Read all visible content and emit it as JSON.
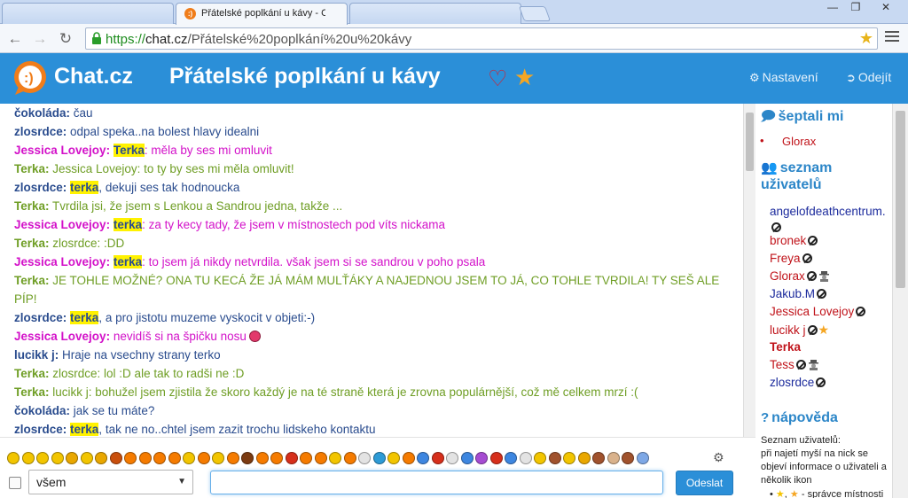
{
  "browser": {
    "tabs": [
      {
        "title": ""
      },
      {
        "title": "Přátelské poplkání u kávy - Chat.cz"
      },
      {
        "title": ""
      }
    ],
    "url_scheme": "https://",
    "url_host": "chat.cz",
    "url_path": "/Přátelské%20poplkání%20u%20kávy"
  },
  "header": {
    "logo_text": "Chat.cz",
    "room_title": "Přátelské poplkání u kávy",
    "settings_label": "Nastavení",
    "logout_label": "Odejít"
  },
  "colors": {
    "accent": "#2b8fd8",
    "nick_dark": "#2a4c8e",
    "nick_green": "#6f9e25",
    "nick_magenta": "#d312c9",
    "nick_red": "#c0131a",
    "highlight": "#fff200"
  },
  "messages": [
    {
      "nick": "čokoláda:",
      "highlight": "",
      "text": " čau",
      "color": "#2a4c8e"
    },
    {
      "nick": "zlosrdce:",
      "highlight": "",
      "text": " odpal speka..na bolest hlavy idealni",
      "color": "#2a4c8e"
    },
    {
      "nick": "Jessica Lovejoy:",
      "highlight": "Terka",
      "text": ": měla by ses mi omluvit",
      "color": "#d312c9"
    },
    {
      "nick": "Terka:",
      "highlight": "",
      "text": " Jessica Lovejoy: to ty by ses mi měla omluvit!",
      "color": "#6f9e25"
    },
    {
      "nick": "zlosrdce:",
      "highlight": "terka",
      "text": ", dekuji ses tak hodnoucka",
      "color": "#2a4c8e"
    },
    {
      "nick": "Terka:",
      "highlight": "",
      "text": " Tvrdila jsi, že jsem s Lenkou a Sandrou jedna, takže ...",
      "color": "#6f9e25"
    },
    {
      "nick": "Jessica Lovejoy:",
      "highlight": "terka",
      "text": ": za ty kecy tady, že jsem v místnostech pod víts nickama",
      "color": "#d312c9"
    },
    {
      "nick": "Terka:",
      "highlight": "",
      "text": " zlosrdce: :DD",
      "color": "#6f9e25"
    },
    {
      "nick": "Jessica Lovejoy:",
      "highlight": "terka",
      "text": ": to jsem já nikdy netvrdila. však jsem si se sandrou v poho psala",
      "color": "#d312c9"
    },
    {
      "nick": "Terka:",
      "highlight": "",
      "text": " JE TOHLE MOŽNÉ? ONA TU KECÁ ŽE JÁ MÁM MULŤÁKY A NAJEDNOU JSEM TO JÁ, CO TOHLE TVRDILA! TY SEŠ ALE PÍP!",
      "color": "#6f9e25"
    },
    {
      "nick": "zlosrdce:",
      "highlight": "terka",
      "text": ", a pro jistotu muzeme vyskocit v objeti:-)",
      "color": "#2a4c8e"
    },
    {
      "nick": "Jessica Lovejoy:",
      "highlight": "",
      "text": " nevidíš si na špičku nosu",
      "color": "#d312c9",
      "smiley": true
    },
    {
      "nick": "lucikk j:",
      "highlight": "",
      "text": " Hraje na vsechny strany terko",
      "color": "#2a4c8e"
    },
    {
      "nick": "Terka:",
      "highlight": "",
      "text": " zlosrdce: lol :D ale tak to radši ne :D",
      "color": "#6f9e25"
    },
    {
      "nick": "Terka:",
      "highlight": "",
      "text": " lucikk j: bohužel jsem zjistila že skoro každý je na té straně která je zrovna populárnější, což mě celkem mrzí :(",
      "color": "#6f9e25"
    },
    {
      "nick": "čokoláda:",
      "highlight": "",
      "text": " jak se tu máte?",
      "color": "#2a4c8e"
    },
    {
      "nick": "zlosrdce:",
      "highlight": "terka",
      "text": ", tak ne no..chtel jsem zazit trochu lidskeho kontaktu",
      "color": "#2a4c8e"
    }
  ],
  "sidebar": {
    "whisper_heading": "šeptali mi",
    "whispers": [
      "Glorax"
    ],
    "users_heading": "seznam uživatelů",
    "users": [
      {
        "name": "angelofdeathcentrum.",
        "color": "#1b2a9c",
        "ban": true,
        "spy": false,
        "star": false,
        "bold": false
      },
      {
        "name": "bronek",
        "color": "#c0131a",
        "ban": true,
        "spy": false,
        "star": false,
        "bold": false
      },
      {
        "name": "Freya",
        "color": "#c0131a",
        "ban": true,
        "spy": false,
        "star": false,
        "bold": false
      },
      {
        "name": "Glorax",
        "color": "#c0131a",
        "ban": true,
        "spy": true,
        "star": false,
        "bold": false
      },
      {
        "name": "Jakub.M",
        "color": "#1b2a9c",
        "ban": true,
        "spy": false,
        "star": false,
        "bold": false
      },
      {
        "name": "Jessica Lovejoy",
        "color": "#c0131a",
        "ban": true,
        "spy": false,
        "star": false,
        "bold": false
      },
      {
        "name": "lucikk j",
        "color": "#c0131a",
        "ban": true,
        "spy": false,
        "star": true,
        "bold": false
      },
      {
        "name": "Terka",
        "color": "#c0131a",
        "ban": false,
        "spy": false,
        "star": false,
        "bold": true
      },
      {
        "name": "Tess",
        "color": "#c0131a",
        "ban": true,
        "spy": true,
        "star": false,
        "bold": false
      },
      {
        "name": "zlosrdce",
        "color": "#1b2a9c",
        "ban": true,
        "spy": false,
        "star": false,
        "bold": false
      }
    ],
    "help_heading": "nápověda",
    "help_title": "Seznam uživatelů:",
    "help_body": "při najetí myší na nick se objeví informace o uživateli a několik ikon",
    "help_item": " - správce místnosti"
  },
  "composer": {
    "recipient": "všem",
    "send_label": "Odeslat",
    "input_value": ""
  },
  "smiley_colors": [
    "#f2c500",
    "#f2c500",
    "#f2c500",
    "#f2c500",
    "#e9a700",
    "#f2c500",
    "#e9a700",
    "#c94f0c",
    "#f57b00",
    "#f57b00",
    "#f57b00",
    "#f57b00",
    "#f2c500",
    "#f57b00",
    "#f2c500",
    "#f57b00",
    "#7b3b12",
    "#f57b00",
    "#f57b00",
    "#d62f1b",
    "#f57b00",
    "#f57b00",
    "#f2c500",
    "#f57b00",
    "#e3e3e3",
    "#2d9bd6",
    "#f2c500",
    "#f57b00",
    "#3d86e0",
    "#d62f1b",
    "#e3e3e3",
    "#3d86e0",
    "#a64cd2",
    "#d62f1b",
    "#3d86e0",
    "#e3e3e3",
    "#f2c500",
    "#a0522d",
    "#f2c500",
    "#e9a700",
    "#a0522d",
    "#d9b28c",
    "#a0522d",
    "#7ea8e6"
  ]
}
